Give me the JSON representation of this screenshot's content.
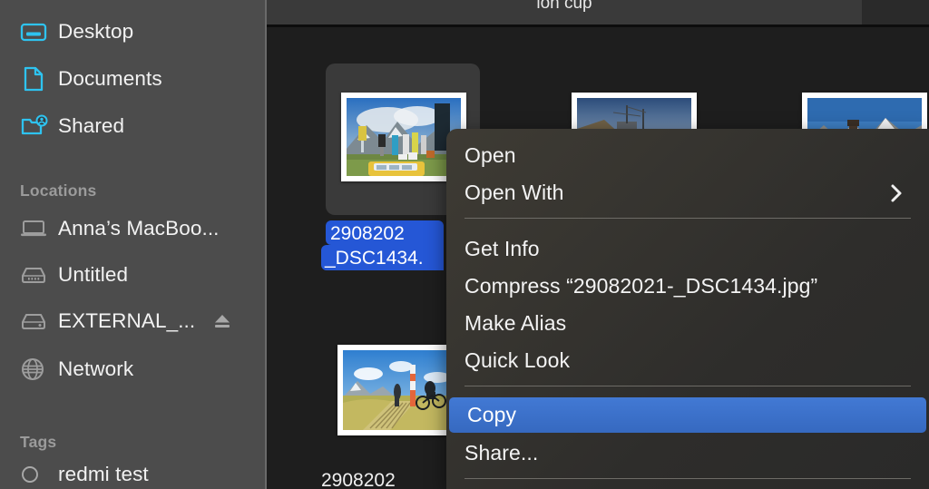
{
  "window": {
    "title": "ion cup"
  },
  "sidebar": {
    "favorites": [
      {
        "label": "Desktop",
        "icon": "desktop-icon"
      },
      {
        "label": "Documents",
        "icon": "document-icon"
      },
      {
        "label": "Shared",
        "icon": "shared-folder-icon"
      }
    ],
    "locations_header": "Locations",
    "locations": [
      {
        "label": "Anna’s MacBoo...",
        "icon": "laptop-icon",
        "eject": false
      },
      {
        "label": "Untitled",
        "icon": "hard-drive-icon",
        "eject": false
      },
      {
        "label": "EXTERNAL_...",
        "icon": "external-drive-icon",
        "eject": true
      },
      {
        "label": "Network",
        "icon": "globe-icon",
        "eject": false
      }
    ],
    "tags_header": "Tags",
    "tags": [
      {
        "label": "redmi test",
        "icon": "tag-circle-icon",
        "color": "none"
      }
    ]
  },
  "files": [
    {
      "name_line1": "2908202",
      "name_line2": "_DSC1434.",
      "selected": true,
      "thumbnail": "mountain-event-van-photo"
    },
    {
      "name_line1": "",
      "name_line2": "",
      "selected": false,
      "thumbnail": "ship-harbor-photo"
    },
    {
      "name_line1": "",
      "name_line2": "",
      "selected": false,
      "thumbnail": "snow-mountain-peak-photo"
    },
    {
      "name_line1": "2908202",
      "name_line2": "",
      "selected": false,
      "thumbnail": "mountain-bikers-trail-photo"
    }
  ],
  "context_menu": {
    "items": [
      {
        "label": "Open",
        "submenu": false,
        "highlighted": false
      },
      {
        "label": "Open With",
        "submenu": true,
        "highlighted": false
      },
      {
        "label": "Get Info",
        "submenu": false,
        "highlighted": false
      },
      {
        "label": "Compress “29082021-_DSC1434.jpg”",
        "submenu": false,
        "highlighted": false
      },
      {
        "label": "Make Alias",
        "submenu": false,
        "highlighted": false
      },
      {
        "label": "Quick Look",
        "submenu": false,
        "highlighted": false
      },
      {
        "label": "Copy",
        "submenu": false,
        "highlighted": true
      },
      {
        "label": "Share...",
        "submenu": false,
        "highlighted": false
      }
    ]
  },
  "colors": {
    "sidebar_bg": "#4c4c4c",
    "content_bg": "#1e1e1e",
    "accent_blue": "#3b72cd",
    "label_blue": "#2557d6",
    "sidebar_icon_blue": "#2ec3f0",
    "menu_text": "#f4f4f4"
  }
}
